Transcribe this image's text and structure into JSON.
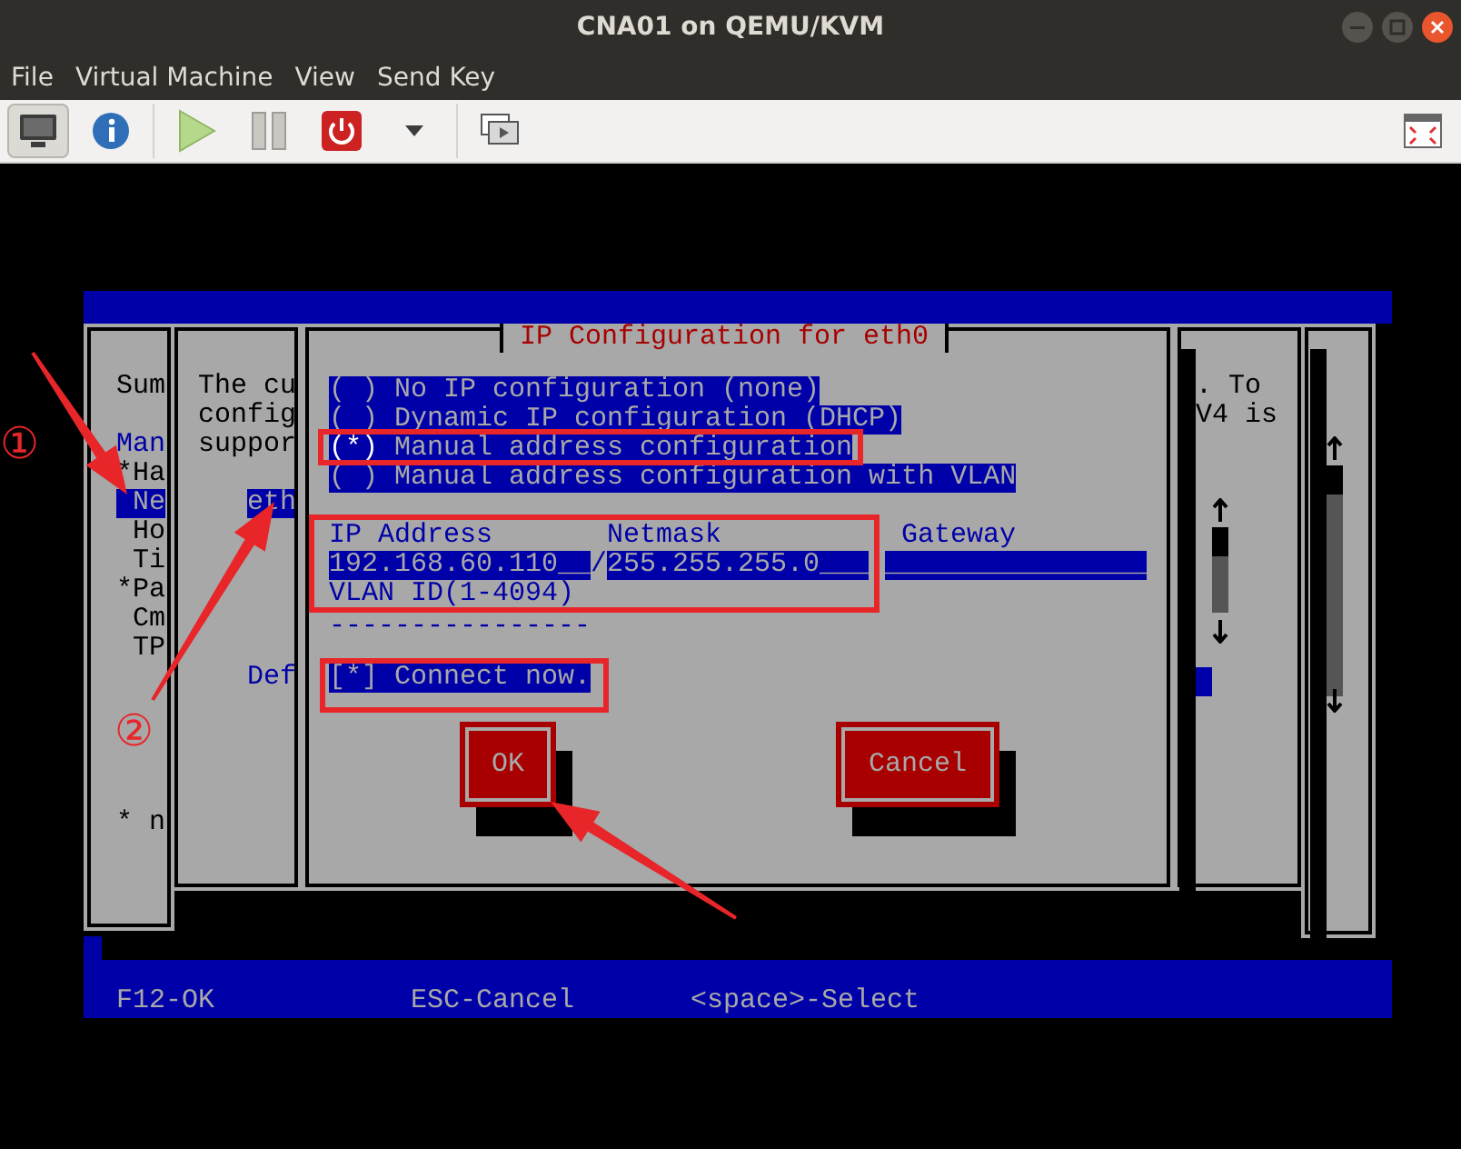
{
  "window": {
    "title": "CNA01 on QEMU/KVM"
  },
  "menu": [
    "File",
    "Virtual Machine",
    "View",
    "Send Key"
  ],
  "toolbar": [
    {
      "kind": "console",
      "selected": true
    },
    {
      "kind": "details",
      "selected": false
    },
    {
      "kind": "run",
      "selected": false
    },
    {
      "kind": "pause",
      "selected": false
    },
    {
      "kind": "shutdown",
      "selected": false
    },
    {
      "kind": "menu",
      "selected": false
    },
    {
      "kind": "snapshots",
      "selected": false
    },
    {
      "kind": "fullscreen",
      "selected": false
    }
  ],
  "console": {
    "left_items": [
      {
        "text": "Sum",
        "kind": "top",
        "selected": false
      },
      {
        "text": "Man",
        "kind": "heading",
        "selected": false
      },
      {
        "text": "*Ha",
        "kind": "top",
        "selected": false
      },
      {
        "text": "Ne",
        "kind": "sub",
        "selected": true
      },
      {
        "text": "Ho",
        "kind": "sub",
        "selected": false
      },
      {
        "text": "Ti",
        "kind": "sub",
        "selected": false
      },
      {
        "text": "*Pa",
        "kind": "top",
        "selected": false
      },
      {
        "text": "Cm",
        "kind": "sub",
        "selected": false
      },
      {
        "text": "TP",
        "kind": "sub",
        "selected": false
      },
      {
        "text": "* n",
        "kind": "top",
        "selected": false
      }
    ],
    "mid_items": [
      {
        "text": "The cu",
        "kind": "plain"
      },
      {
        "text": "config",
        "kind": "plain"
      },
      {
        "text": "suppor",
        "kind": "plain"
      },
      {
        "text": "eth",
        "kind": "selected"
      },
      {
        "text": "Def",
        "kind": "heading"
      }
    ],
    "right_items": [
      ". To",
      "V4 is"
    ],
    "dialog": {
      "title": "IP Configuration for eth0",
      "radio_marks": {
        "on": "(*)",
        "off": "( )"
      },
      "options": [
        {
          "label": "No IP configuration (none)",
          "selected": false
        },
        {
          "label": "Dynamic IP configuration (DHCP)",
          "selected": false
        },
        {
          "label": "Manual address configuration",
          "selected": true
        },
        {
          "label": "Manual address configuration with VLAN",
          "selected": false
        }
      ],
      "ip": {
        "label": "IP Address",
        "value": "192.168.60.110__"
      },
      "separator": "/",
      "netmask": {
        "label": "Netmask",
        "value": "255.255.255.0___"
      },
      "gateway": {
        "label": "Gateway",
        "value": "________________"
      },
      "vlan": {
        "label": "VLAN ID(1-4094)",
        "value": "----------------"
      },
      "connect": {
        "check_mark": "[*]",
        "label": "Connect now.",
        "checked": true
      },
      "buttons": [
        "OK",
        "Cancel"
      ]
    },
    "footer": [
      "F12-OK",
      "ESC-Cancel",
      "<space>-Select"
    ]
  },
  "annotations": {
    "markers": [
      "①",
      "②"
    ]
  }
}
